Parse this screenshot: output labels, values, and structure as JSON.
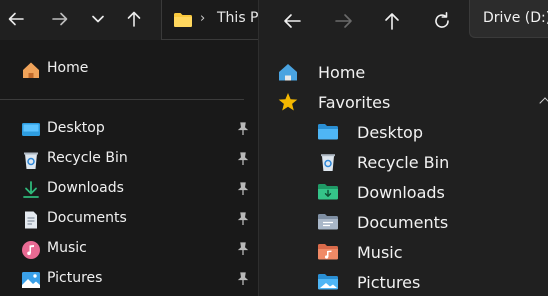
{
  "left_window": {
    "toolbar": {
      "back_icon": "arrow-left-icon",
      "forward_icon": "arrow-right-icon",
      "recent_icon": "chevron-down-icon",
      "up_icon": "arrow-up-icon"
    },
    "address": {
      "folder_icon": "folder-icon",
      "separator": "›",
      "crumb": "This PC"
    },
    "nav": {
      "home": "Home",
      "items": [
        {
          "label": "Desktop",
          "icon": "desktop-icon"
        },
        {
          "label": "Recycle Bin",
          "icon": "recycle-bin-icon"
        },
        {
          "label": "Downloads",
          "icon": "downloads-icon"
        },
        {
          "label": "Documents",
          "icon": "documents-icon"
        },
        {
          "label": "Music",
          "icon": "music-icon"
        },
        {
          "label": "Pictures",
          "icon": "pictures-icon"
        }
      ]
    }
  },
  "right_window": {
    "toolbar": {
      "back_icon": "arrow-left-icon",
      "forward_icon": "arrow-right-icon",
      "up_icon": "arrow-up-icon",
      "refresh_icon": "refresh-icon",
      "drive": "Drive (D:)"
    },
    "nav": {
      "home": "Home",
      "favorites": "Favorites",
      "items": [
        {
          "label": "Desktop",
          "icon": "desktop-icon"
        },
        {
          "label": "Recycle Bin",
          "icon": "recycle-bin-icon"
        },
        {
          "label": "Downloads",
          "icon": "downloads-icon"
        },
        {
          "label": "Documents",
          "icon": "documents-icon"
        },
        {
          "label": "Music",
          "icon": "music-icon"
        },
        {
          "label": "Pictures",
          "icon": "pictures-icon"
        }
      ]
    }
  },
  "colors": {
    "accent_blue": "#4cc2ff",
    "folder_yellow": "#f9c93e",
    "download_green": "#2fb87a",
    "star_gold": "#f5b800",
    "music_pink": "#e1578a"
  }
}
